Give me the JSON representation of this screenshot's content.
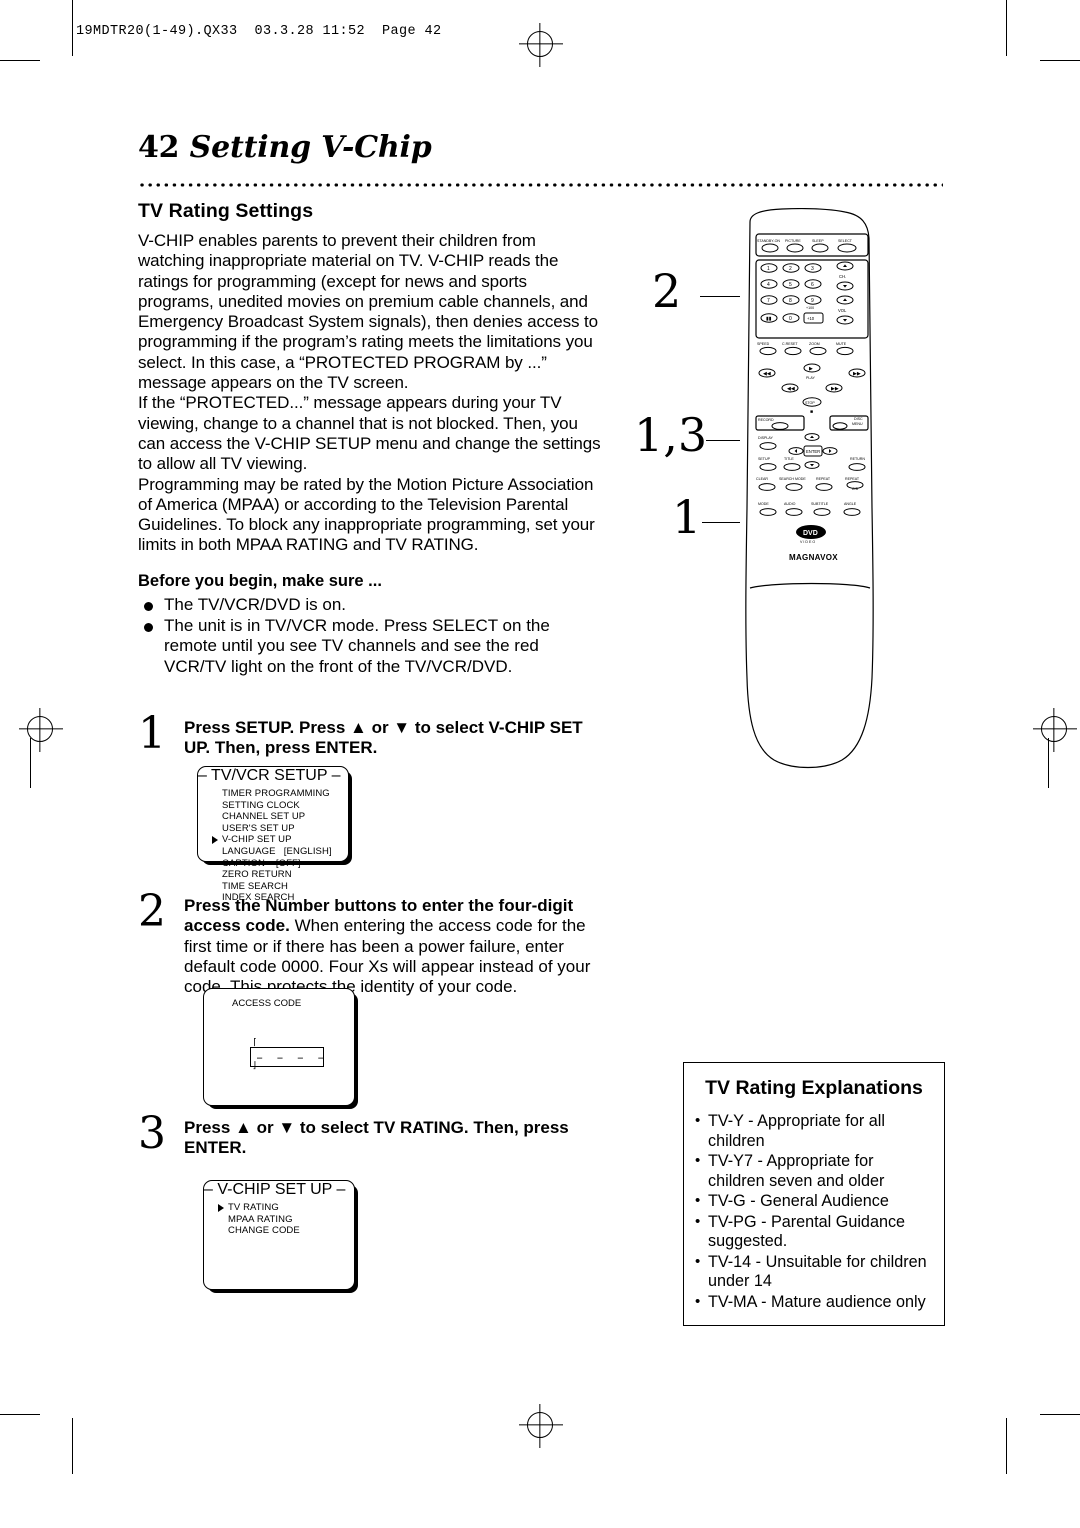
{
  "slug": "19MDTR20(1-49).QX33  03.3.28 11:52  Page 42",
  "title": {
    "number": "42",
    "text": "Setting V-Chip"
  },
  "section": {
    "heading": "TV Rating Settings",
    "paragraphs": [
      "V-CHIP enables parents to prevent their children from watching inappropriate material on TV. V-CHIP reads the ratings for programming (except for news and sports programs, unedited movies on premium cable channels, and Emergency Broadcast System signals), then denies access to programming if the program’s rating meets the limitations you select. In this case, a “PROTECTED PROGRAM by ...” message appears on the TV screen.",
      "If the “PROTECTED...” message appears during your TV viewing, change to a channel that is not blocked. Then, you can access the V-CHIP SETUP menu and change the settings to allow all TV viewing.",
      "Programming may be rated by the Motion Picture Association of America (MPAA) or according to the Television Parental Guidelines. To block any inappropriate programming, set your limits in both MPAA RATING and TV RATING."
    ],
    "before_heading": "Before you begin, make sure ...",
    "before_items": [
      "The TV/VCR/DVD is on.",
      "The unit is in TV/VCR mode. Press SELECT on the remote until you see TV channels and see the red VCR/TV light on the front of the TV/VCR/DVD."
    ]
  },
  "steps": [
    {
      "number": "1",
      "text_bold": "Press SETUP. Press ▲ or ▼ to select V-CHIP SET UP. Then, press ENTER.",
      "text_rest": ""
    },
    {
      "number": "2",
      "text_bold": "Press the Number buttons to enter the four-digit access code.",
      "text_rest": " When entering the access code for the first time or if there has been a power failure, enter default code 0000. Four Xs will appear instead of your code. This protects the identity of your code."
    },
    {
      "number": "3",
      "text_bold": "Press ▲ or ▼ to select TV RATING. Then, press ENTER.",
      "text_rest": ""
    }
  ],
  "screen_setup": {
    "header": "– TV/VCR SETUP –",
    "items": [
      "TIMER PROGRAMMING",
      "SETTING CLOCK",
      "CHANNEL SET UP",
      "USER'S SET UP",
      "V-CHIP SET UP",
      "LANGUAGE   [ENGLISH]",
      "CAPTION    [OFF]",
      "ZERO RETURN",
      "TIME SEARCH",
      "INDEX SEARCH"
    ],
    "selected_index": 4
  },
  "screen_access": {
    "header": "ACCESS CODE",
    "dashes": "– – – –"
  },
  "screen_vchip": {
    "header": "– V-CHIP SET UP –",
    "items": [
      "TV RATING",
      "MPAA RATING",
      "CHANGE CODE"
    ],
    "selected_index": 0
  },
  "callouts": {
    "two": "2",
    "one_three": "1,3",
    "one": "1"
  },
  "remote": {
    "brand": "MAGNAVOX",
    "dvd_logo": "DVD",
    "dvd_sub": "V I D E O",
    "top_row": [
      "STANDBY-ON",
      "PICTURE",
      "SLEEP",
      "SELECT"
    ],
    "numbers": [
      "1",
      "2",
      "3",
      "4",
      "5",
      "6",
      "7",
      "8",
      "9",
      "▮▮",
      "0",
      "+10"
    ],
    "side_labels": [
      "CH.",
      "VOL",
      "MUTE"
    ],
    "plus100": "+100",
    "fn_row": [
      "SPEED",
      "C.RESET",
      "ZOOM"
    ],
    "transport": [
      "PLAY",
      "STOP"
    ],
    "mid_left": [
      "RECORD",
      "DISPLAY",
      "SETUP",
      "CLEAR",
      "MODE"
    ],
    "mid_right": [
      "DISC MENU",
      "RETURN",
      "REPEAT",
      "ANGLE"
    ],
    "center_button": "ENTER",
    "row_titles": [
      "TITLE"
    ],
    "bottom_row": [
      "MODE",
      "AUDIO",
      "SUBTITLE",
      "ANGLE"
    ],
    "search_mode": "SEARCH MODE",
    "repeat_ab": "A-B"
  },
  "explanations": {
    "heading": "TV Rating Explanations",
    "items": [
      "TV-Y - Appropriate for all children",
      "TV-Y7 - Appropriate for children seven and older",
      "TV-G - General Audience",
      "TV-PG - Parental Guidance suggested.",
      "TV-14 - Unsuitable for children under 14",
      "TV-MA - Mature audience only"
    ]
  }
}
